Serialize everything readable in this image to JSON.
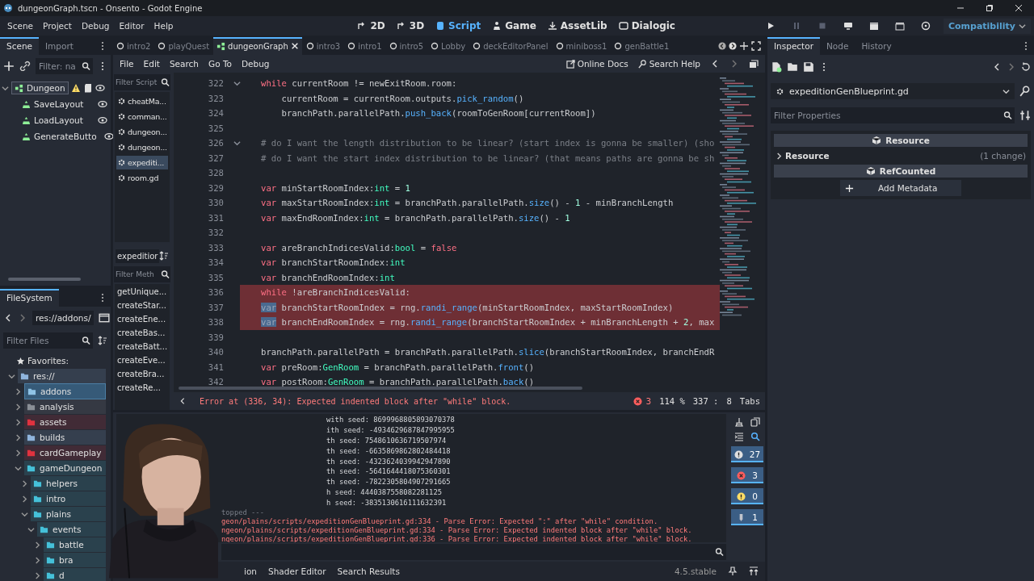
{
  "window": {
    "title": "dungeonGraph.tscn - Onsento - Godot Engine"
  },
  "menu": [
    "Scene",
    "Project",
    "Debug",
    "Editor",
    "Help"
  ],
  "workspaces": [
    {
      "label": "2D",
      "selected": false
    },
    {
      "label": "3D",
      "selected": false
    },
    {
      "label": "Script",
      "selected": true
    },
    {
      "label": "Game",
      "selected": false
    },
    {
      "label": "AssetLib",
      "selected": false
    },
    {
      "label": "Dialogic",
      "selected": false
    }
  ],
  "renderer": "Compatibility",
  "scene_dock": {
    "tabs": [
      {
        "label": "Scene",
        "selected": true
      },
      {
        "label": "Import",
        "selected": false
      }
    ],
    "filter_placeholder": "Filter: na",
    "tree": [
      {
        "name": "Dungeon",
        "selected": true,
        "warning": true,
        "children": [
          {
            "name": "SaveLayout",
            "selected": false
          },
          {
            "name": "LoadLayout",
            "selected": false
          },
          {
            "name": "GenerateButto",
            "selected": false
          }
        ]
      }
    ]
  },
  "filesystem": {
    "tab": "FileSystem",
    "path": "res://addons/",
    "filter_placeholder": "Filter Files",
    "favorites": "Favorites:",
    "tree": [
      {
        "name": "res://",
        "color": "#8fb4dc",
        "expanded": true,
        "selected": false,
        "children": [
          {
            "name": "addons",
            "color": "#8fc3e6",
            "expanded": false,
            "selected": true
          },
          {
            "name": "analysis",
            "color": "#8a8f96",
            "expanded": false,
            "selected": false
          },
          {
            "name": "assets",
            "color": "#e0323f",
            "expanded": false,
            "selected": false
          },
          {
            "name": "builds",
            "color": "#8fb4dc",
            "expanded": false,
            "selected": false
          },
          {
            "name": "cardGameplay",
            "color": "#e0323f",
            "expanded": false,
            "selected": false
          },
          {
            "name": "gameDungeon",
            "color": "#45c1d9",
            "expanded": true,
            "selected": false,
            "children": [
              {
                "name": "helpers",
                "color": "#45c1d9",
                "expanded": false,
                "selected": false
              },
              {
                "name": "intro",
                "color": "#45c1d9",
                "expanded": false,
                "selected": false
              },
              {
                "name": "plains",
                "color": "#45c1d9",
                "expanded": true,
                "selected": false,
                "children": [
                  {
                    "name": "events",
                    "color": "#45c1d9",
                    "expanded": true,
                    "selected": false,
                    "children": [
                      {
                        "name": "battle",
                        "color": "#45c1d9",
                        "expanded": false,
                        "selected": false
                      },
                      {
                        "name": "bra",
                        "color": "#45c1d9",
                        "expanded": false,
                        "selected": false
                      },
                      {
                        "name": "d",
                        "color": "#45c1d9",
                        "expanded": false,
                        "selected": false
                      }
                    ]
                  }
                ]
              }
            ]
          }
        ]
      }
    ]
  },
  "editor_tabs": [
    {
      "label": "intro2",
      "selected": false
    },
    {
      "label": "playQuest",
      "selected": false
    },
    {
      "label": "dungeonGraph",
      "selected": true
    },
    {
      "label": "intro3",
      "selected": false
    },
    {
      "label": "intro1",
      "selected": false
    },
    {
      "label": "intro5",
      "selected": false
    },
    {
      "label": "Lobby",
      "selected": false
    },
    {
      "label": "deckEditorPanel",
      "selected": false
    },
    {
      "label": "miniboss1",
      "selected": false
    },
    {
      "label": "genBattle1",
      "selected": false
    }
  ],
  "script_menu": [
    "File",
    "Edit",
    "Search",
    "Go To",
    "Debug"
  ],
  "help_buttons": [
    "Online Docs",
    "Search Help"
  ],
  "scripts": {
    "filter_placeholder": "Filter Script",
    "items": [
      {
        "name": "cheatMa...",
        "selected": false
      },
      {
        "name": "comman...",
        "selected": false
      },
      {
        "name": "dungeon...",
        "selected": false
      },
      {
        "name": "dungeon...",
        "selected": false
      },
      {
        "name": "expediti...",
        "selected": true
      },
      {
        "name": "room.gd",
        "selected": false
      }
    ]
  },
  "methods": {
    "title": "expeditior",
    "filter_placeholder": "Filter Meth",
    "items": [
      "getUnique...",
      "createStar...",
      "createEne...",
      "createBas...",
      "createBatt...",
      "createEve...",
      "createBra...",
      "createRe..."
    ]
  },
  "code": [
    {
      "num": "322",
      "foldable": true,
      "error": false,
      "parts": [
        {
          "kind": "kw",
          "text": "while"
        },
        {
          "kind": "tx",
          "text": " currentRoom != newExitRoom.room:"
        }
      ]
    },
    {
      "num": "323",
      "foldable": false,
      "error": false,
      "parts": [
        {
          "kind": "tx",
          "text": "    currentRoom = currentRoom.outputs."
        },
        {
          "kind": "fn",
          "text": "pick_random"
        },
        {
          "kind": "tx",
          "text": "()"
        }
      ]
    },
    {
      "num": "324",
      "foldable": false,
      "error": false,
      "parts": [
        {
          "kind": "tx",
          "text": "    branchPath.parallelPath."
        },
        {
          "kind": "fn",
          "text": "push_back"
        },
        {
          "kind": "tx",
          "text": "(roomToGenRoom[currentRoom])"
        }
      ]
    },
    {
      "num": "325",
      "foldable": false,
      "error": false
    },
    {
      "num": "326",
      "foldable": true,
      "error": false,
      "parts": [
        {
          "kind": "cmt",
          "text": "# do I want the length distribution to be linear? (start index is gonna be smaller) (sho"
        }
      ]
    },
    {
      "num": "327",
      "foldable": false,
      "error": false,
      "parts": [
        {
          "kind": "cmt",
          "text": "# do I want the start index distribution to be linear? (that means paths are gonna be sh"
        }
      ]
    },
    {
      "num": "328",
      "foldable": false,
      "error": false
    },
    {
      "num": "329",
      "foldable": false,
      "error": false,
      "parts": [
        {
          "kind": "kw",
          "text": "var"
        },
        {
          "kind": "tx",
          "text": " minStartRoomIndex:"
        },
        {
          "kind": "type",
          "text": "int"
        },
        {
          "kind": "tx",
          "text": " = "
        },
        {
          "kind": "num",
          "text": "1"
        }
      ]
    },
    {
      "num": "330",
      "foldable": false,
      "error": false,
      "parts": [
        {
          "kind": "kw",
          "text": "var"
        },
        {
          "kind": "tx",
          "text": " maxStartRoomIndex:"
        },
        {
          "kind": "type",
          "text": "int"
        },
        {
          "kind": "tx",
          "text": " = branchPath.parallelPath."
        },
        {
          "kind": "fn",
          "text": "size"
        },
        {
          "kind": "tx",
          "text": "() - "
        },
        {
          "kind": "num",
          "text": "1"
        },
        {
          "kind": "tx",
          "text": " - minBranchLength"
        }
      ]
    },
    {
      "num": "331",
      "foldable": false,
      "error": false,
      "parts": [
        {
          "kind": "kw",
          "text": "var"
        },
        {
          "kind": "tx",
          "text": " maxEndRoomIndex:"
        },
        {
          "kind": "type",
          "text": "int"
        },
        {
          "kind": "tx",
          "text": " = branchPath.parallelPath."
        },
        {
          "kind": "fn",
          "text": "size"
        },
        {
          "kind": "tx",
          "text": "() - "
        },
        {
          "kind": "num",
          "text": "1"
        }
      ]
    },
    {
      "num": "332",
      "foldable": false,
      "error": false
    },
    {
      "num": "333",
      "foldable": false,
      "error": false,
      "parts": [
        {
          "kind": "kw",
          "text": "var"
        },
        {
          "kind": "tx",
          "text": " areBranchIndicesValid:"
        },
        {
          "kind": "type",
          "text": "bool"
        },
        {
          "kind": "tx",
          "text": " = "
        },
        {
          "kind": "kw",
          "text": "false"
        }
      ]
    },
    {
      "num": "334",
      "foldable": false,
      "error": false,
      "parts": [
        {
          "kind": "kw",
          "text": "var"
        },
        {
          "kind": "tx",
          "text": " branchStartRoomIndex:"
        },
        {
          "kind": "type",
          "text": "int"
        }
      ]
    },
    {
      "num": "335",
      "foldable": false,
      "error": false,
      "parts": [
        {
          "kind": "kw",
          "text": "var"
        },
        {
          "kind": "tx",
          "text": " branchEndRoomIndex:"
        },
        {
          "kind": "type",
          "text": "int"
        }
      ]
    },
    {
      "num": "336",
      "foldable": false,
      "error": true,
      "parts": [
        {
          "kind": "kw",
          "text": "while"
        },
        {
          "kind": "tx",
          "text": " !areBranchIndicesValid:"
        }
      ]
    },
    {
      "num": "337",
      "foldable": false,
      "error": true,
      "parts": [
        {
          "kind": "sel",
          "text": "var"
        },
        {
          "kind": "tx",
          "text": " branchStartRoomIndex = rng."
        },
        {
          "kind": "fn",
          "text": "randi_range"
        },
        {
          "kind": "tx",
          "text": "(minStartRoomIndex, maxStartRoomIndex)"
        }
      ]
    },
    {
      "num": "338",
      "foldable": false,
      "error": true,
      "parts": [
        {
          "kind": "sel",
          "text": "var"
        },
        {
          "kind": "tx",
          "text": " branchEndRoomIndex = rng."
        },
        {
          "kind": "fn",
          "text": "randi_range"
        },
        {
          "kind": "tx",
          "text": "(branchStartRoomIndex + minBranchLength + "
        },
        {
          "kind": "num",
          "text": "2"
        },
        {
          "kind": "tx",
          "text": ", max"
        }
      ]
    },
    {
      "num": "339",
      "foldable": false,
      "error": false
    },
    {
      "num": "340",
      "foldable": false,
      "error": false,
      "parts": [
        {
          "kind": "tx",
          "text": "branchPath.parallelPath = branchPath.parallelPath."
        },
        {
          "kind": "fn",
          "text": "slice"
        },
        {
          "kind": "tx",
          "text": "(branchStartRoomIndex, branchEndR"
        }
      ]
    },
    {
      "num": "341",
      "foldable": false,
      "error": false,
      "parts": [
        {
          "kind": "kw",
          "text": "var"
        },
        {
          "kind": "tx",
          "text": " preRoom:"
        },
        {
          "kind": "type",
          "text": "GenRoom"
        },
        {
          "kind": "tx",
          "text": " = branchPath.parallelPath."
        },
        {
          "kind": "fn",
          "text": "front"
        },
        {
          "kind": "tx",
          "text": "()"
        }
      ]
    },
    {
      "num": "342",
      "foldable": false,
      "error": false,
      "parts": [
        {
          "kind": "kw",
          "text": "var"
        },
        {
          "kind": "tx",
          "text": " postRoom:"
        },
        {
          "kind": "type",
          "text": "GenRoom"
        },
        {
          "kind": "tx",
          "text": " = branchPath.parallelPath."
        },
        {
          "kind": "fn",
          "text": "back"
        },
        {
          "kind": "tx",
          "text": "()"
        }
      ]
    }
  ],
  "status": {
    "error": "Error at (336, 34): Expected indented block after \"while\" block.",
    "error_count": "3",
    "zoom": "114 %",
    "line": "337 :",
    "column": "8",
    "indent": "Tabs"
  },
  "output": {
    "lines": [
      {
        "kind": "log",
        "text": "with seed: 8699968805893070378"
      },
      {
        "kind": "log",
        "text": "ith seed: -4934629687847995955"
      },
      {
        "kind": "log",
        "text": "th seed: 7548610636719507974"
      },
      {
        "kind": "log",
        "text": "th seed: -6635869862802484418"
      },
      {
        "kind": "log",
        "text": "th seed: -4323624039942947890"
      },
      {
        "kind": "log",
        "text": "th seed: -5641644418075360301"
      },
      {
        "kind": "log",
        "text": "th seed: -7822305804907291665"
      },
      {
        "kind": "log",
        "text": "h seed: 4440387558082281125"
      },
      {
        "kind": "log",
        "text": "h seed: -3835130616111632391"
      },
      {
        "kind": "muted",
        "text": "topped ---"
      },
      {
        "kind": "error",
        "text": "geon/plains/scripts/expeditionGenBlueprint.gd:334 - Parse Error: Expected \":\" after \"while\" condition."
      },
      {
        "kind": "error",
        "text": "ngeon/plains/scripts/expeditionGenBlueprint.gd:334 - Parse Error: Expected indented block after \"while\" block."
      },
      {
        "kind": "error",
        "text": "ngeon/plains/scripts/expeditionGenBlueprint.gd:336 - Parse Error: Expected indented block after \"while\" block."
      }
    ],
    "filters": [
      {
        "kind": "message",
        "count": "27",
        "on": true
      },
      {
        "kind": "error",
        "count": "3",
        "on": true
      },
      {
        "kind": "warning",
        "count": "0",
        "on": true
      },
      {
        "kind": "editor",
        "count": "1",
        "on": true
      }
    ]
  },
  "bottom_tabs": [
    {
      "label": "ion",
      "selected": false
    },
    {
      "label": "Shader Editor",
      "selected": false
    },
    {
      "label": "Search Results",
      "selected": false
    }
  ],
  "version": "4.5.stable",
  "inspector": {
    "tabs": [
      {
        "label": "Inspector",
        "selected": true
      },
      {
        "label": "Node",
        "selected": false
      },
      {
        "label": "History",
        "selected": false
      }
    ],
    "resource": "expeditionGenBlueprint.gd",
    "filter_placeholder": "Filter Properties",
    "sections": [
      {
        "kind": "header",
        "label": "Resource"
      },
      {
        "kind": "property",
        "label": "Resource",
        "note": "(1 change)"
      },
      {
        "kind": "header",
        "label": "RefCounted"
      },
      {
        "kind": "button",
        "label": "Add Metadata"
      }
    ]
  }
}
